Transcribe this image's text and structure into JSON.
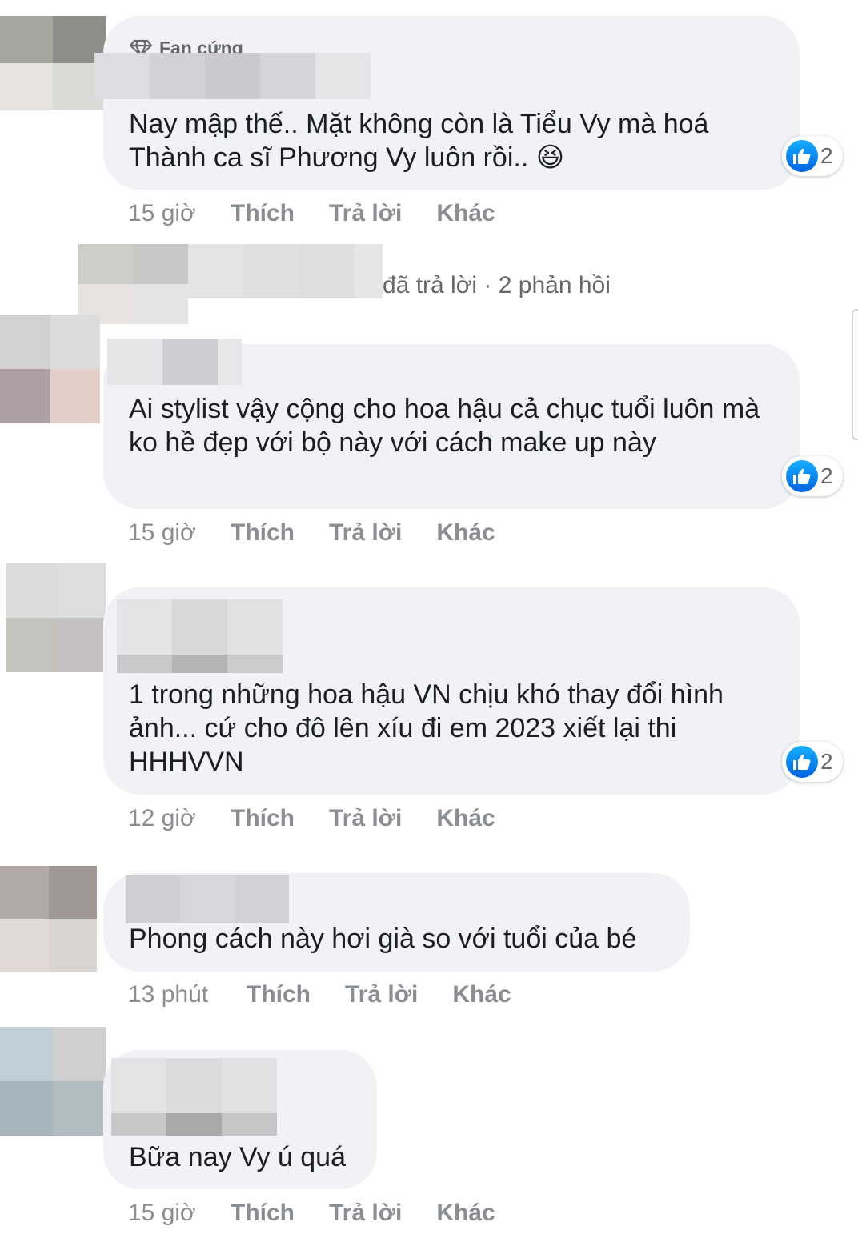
{
  "colors": {
    "bubble": "#f0f2f5",
    "text": "#1c1e21",
    "meta": "#65676b",
    "like_blue": "#1877f2"
  },
  "comments": [
    {
      "badge_icon": "diamond-icon",
      "badge": "Fan cứng",
      "text": "Nay mập thế.. Mặt không còn là Tiểu Vy mà hoá Thành ca sĩ Phương Vy luôn rồi.. 😆",
      "reaction_icon": "like-icon",
      "reactions": "2",
      "time": "15 giờ",
      "like": "Thích",
      "reply": "Trả lời",
      "more": "Khác"
    },
    {
      "text": "Ai stylist vậy cộng cho hoa hậu cả chục tuổi luôn mà ko hề đẹp với bộ này với cách make up này",
      "reaction_icon": "like-icon",
      "reactions": "2",
      "time": "15 giờ",
      "like": "Thích",
      "reply": "Trả lời",
      "more": "Khác"
    },
    {
      "text": "1 trong những hoa hậu VN chịu khó thay đổi hình ảnh... cứ cho đô lên xíu đi em 2023 xiết lại thi HHHVVN",
      "reaction_icon": "like-icon",
      "reactions": "2",
      "time": "12 giờ",
      "like": "Thích",
      "reply": "Trả lời",
      "more": "Khác"
    },
    {
      "text": "Phong cách này hơi già so với tuổi của bé",
      "time": "13 phút",
      "like": "Thích",
      "reply": "Trả lời",
      "more": "Khác"
    },
    {
      "text": "Bữa nay Vy ú quá",
      "time": "15 giờ",
      "like": "Thích",
      "reply": "Trả lời",
      "more": "Khác"
    }
  ],
  "replies_summary": {
    "replied": "đã trả lời",
    "separator": "·",
    "count": "2 phản hồi"
  }
}
